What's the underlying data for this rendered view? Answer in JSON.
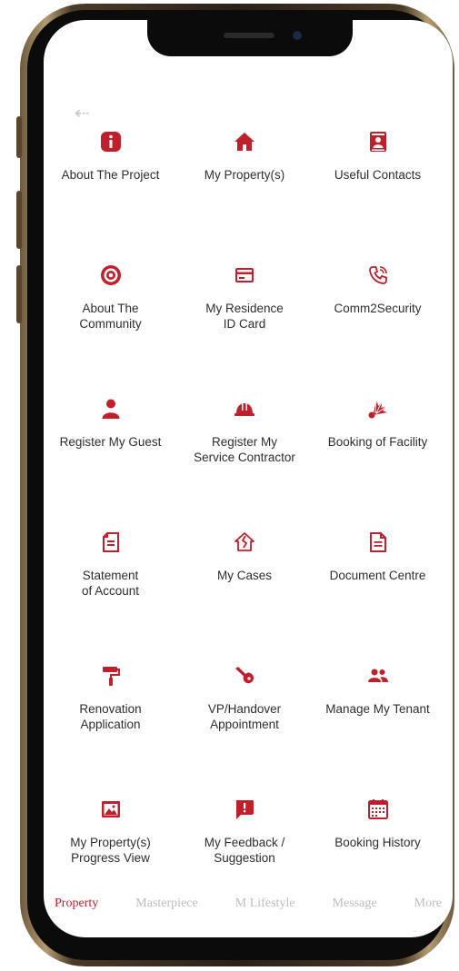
{
  "accent_color": "#c0202b",
  "nav": {
    "back_icon": "back-arrow-icon"
  },
  "grid": {
    "items": [
      {
        "label": "About The Project",
        "icon": "info-icon"
      },
      {
        "label": "My Property(s)",
        "icon": "home-icon"
      },
      {
        "label": "Useful Contacts",
        "icon": "contacts-book-icon"
      },
      {
        "label": "About The\nCommunity",
        "icon": "target-icon"
      },
      {
        "label": "My Residence\nID Card",
        "icon": "id-card-icon"
      },
      {
        "label": "Comm2Security",
        "icon": "phone-call-icon"
      },
      {
        "label": "Register My Guest",
        "icon": "person-icon"
      },
      {
        "label": "Register My\nService Contractor",
        "icon": "hard-hat-icon"
      },
      {
        "label": "Booking of Facility",
        "icon": "shuttlecock-icon"
      },
      {
        "label": "Statement\nof Account",
        "icon": "statement-icon"
      },
      {
        "label": "My Cases",
        "icon": "broken-house-icon"
      },
      {
        "label": "Document Centre",
        "icon": "document-icon"
      },
      {
        "label": "Renovation\nApplication",
        "icon": "paint-roller-icon"
      },
      {
        "label": "VP/Handover\nAppointment",
        "icon": "key-icon"
      },
      {
        "label": "Manage My Tenant",
        "icon": "people-icon"
      },
      {
        "label": "My Property(s)\nProgress View",
        "icon": "picture-icon"
      },
      {
        "label": "My Feedback /\nSuggestion",
        "icon": "feedback-icon"
      },
      {
        "label": "Booking History",
        "icon": "calendar-icon"
      }
    ]
  },
  "tabs": [
    {
      "label": "Property",
      "active": true
    },
    {
      "label": "Masterpiece",
      "active": false
    },
    {
      "label": "M Lifestyle",
      "active": false
    },
    {
      "label": "Message",
      "active": false
    },
    {
      "label": "More",
      "active": false
    }
  ]
}
